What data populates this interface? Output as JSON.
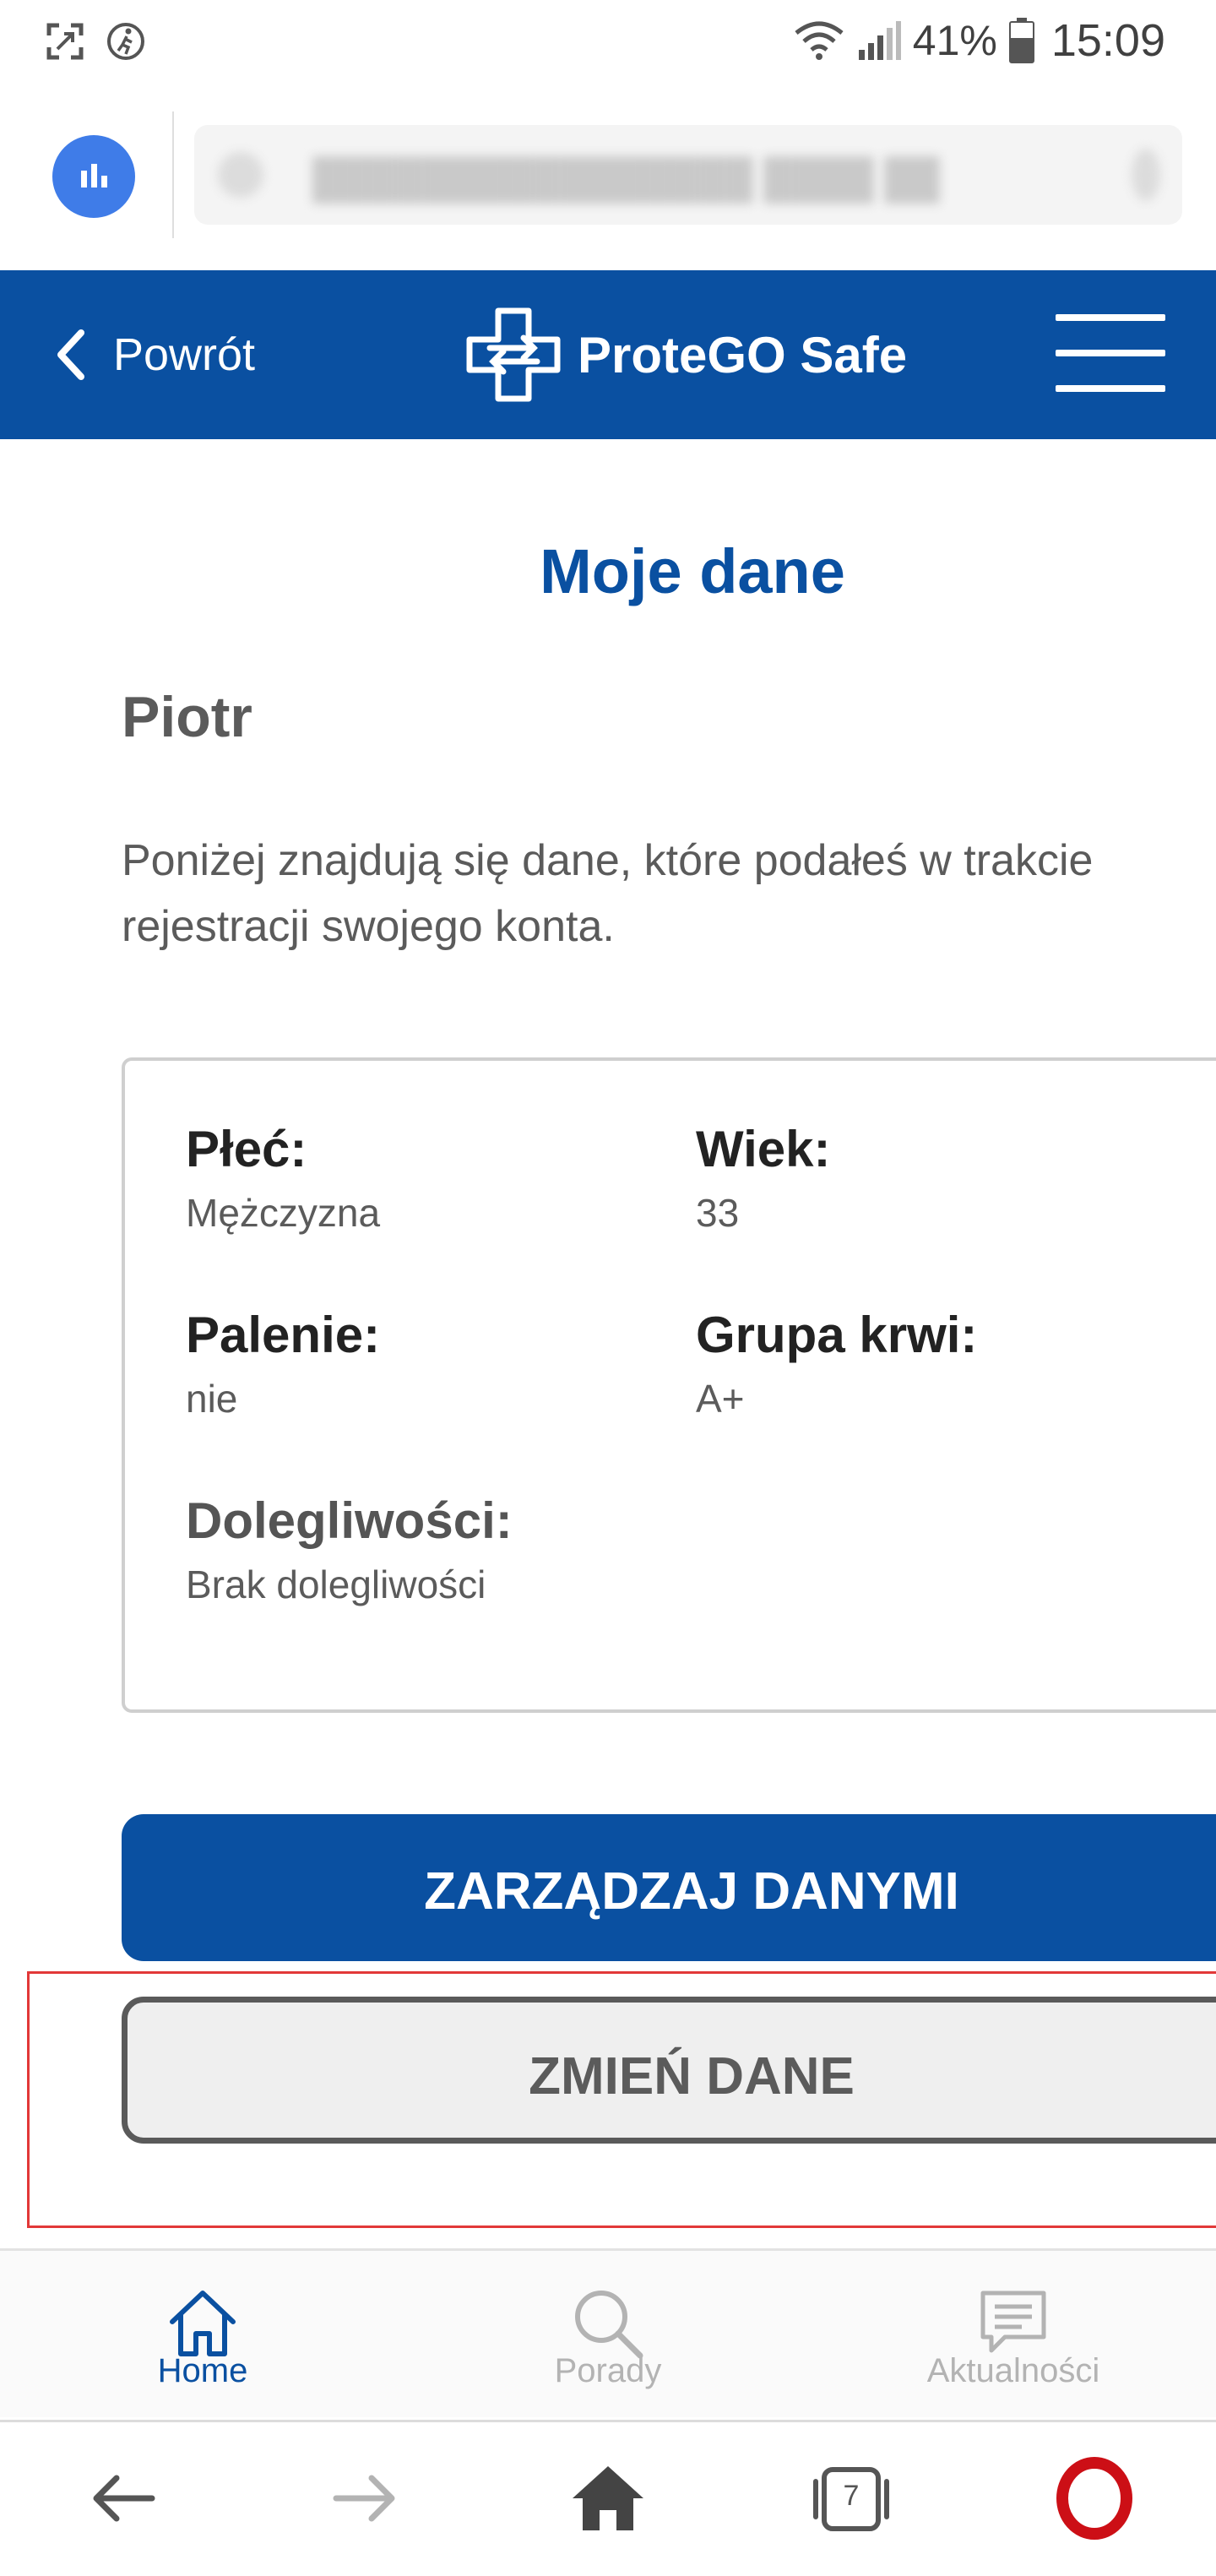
{
  "status_bar": {
    "battery_percent": "41%",
    "time": "15:09",
    "icons": [
      "screenshot-icon",
      "running-person-icon",
      "wifi-icon",
      "signal-icon",
      "battery-icon"
    ]
  },
  "browser": {
    "app_icon": "bar-chart-icon",
    "open_tabs": "7"
  },
  "header": {
    "back_label": "Powrót",
    "app_name": "ProteGO Safe",
    "colors": {
      "brand": "#0a50a1",
      "background": "#ffffff"
    }
  },
  "page": {
    "title": "Moje dane",
    "user_name": "Piotr",
    "intro": "Poniżej znajdują się dane, które podałeś w trakcie rejestracji swojego konta."
  },
  "profile": {
    "sex_label": "Płeć:",
    "sex_value": "Mężczyzna",
    "age_label": "Wiek:",
    "age_value": "33",
    "smoking_label": "Palenie:",
    "smoking_value": "nie",
    "blood_label": "Grupa krwi:",
    "blood_value": "A+",
    "ailments_label": "Dolegliwości:",
    "ailments_value": "Brak dolegliwości"
  },
  "actions": {
    "manage_label": "ZARZĄDZAJ DANYMI",
    "change_label": "ZMIEŃ DANE"
  },
  "bottom_nav": {
    "home": "Home",
    "tips": "Porady",
    "news": "Aktualności"
  }
}
